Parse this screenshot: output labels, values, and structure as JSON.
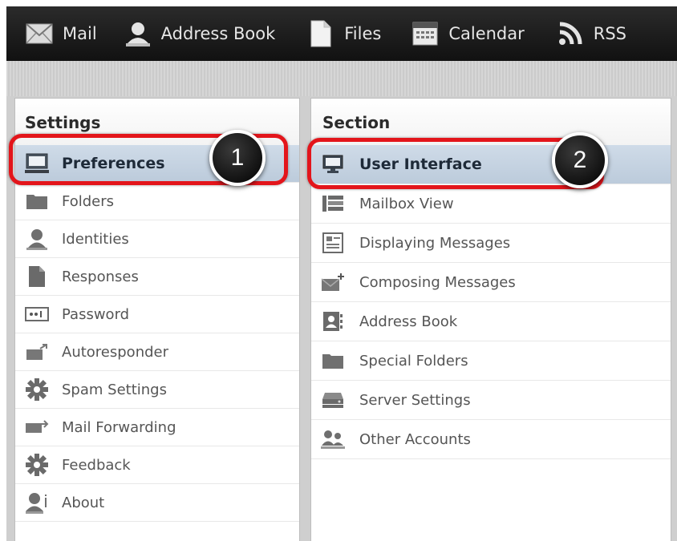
{
  "topnav": {
    "items": [
      {
        "label": "Mail",
        "icon": "mail-icon"
      },
      {
        "label": "Address Book",
        "icon": "person-icon"
      },
      {
        "label": "Files",
        "icon": "file-icon"
      },
      {
        "label": "Calendar",
        "icon": "calendar-icon"
      },
      {
        "label": "RSS",
        "icon": "rss-icon"
      }
    ]
  },
  "settings": {
    "title": "Settings",
    "items": [
      {
        "label": "Preferences",
        "icon": "monitor-icon",
        "selected": true
      },
      {
        "label": "Folders",
        "icon": "folder-icon"
      },
      {
        "label": "Identities",
        "icon": "person-icon"
      },
      {
        "label": "Responses",
        "icon": "document-icon"
      },
      {
        "label": "Password",
        "icon": "password-icon"
      },
      {
        "label": "Autoresponder",
        "icon": "autoresponder-icon"
      },
      {
        "label": "Spam Settings",
        "icon": "gear-icon"
      },
      {
        "label": "Mail Forwarding",
        "icon": "mail-forward-icon"
      },
      {
        "label": "Feedback",
        "icon": "gear-icon"
      },
      {
        "label": "About",
        "icon": "person-info-icon"
      }
    ]
  },
  "section": {
    "title": "Section",
    "items": [
      {
        "label": "User Interface",
        "icon": "monitor-icon",
        "selected": true
      },
      {
        "label": "Mailbox View",
        "icon": "list-view-icon"
      },
      {
        "label": "Displaying Messages",
        "icon": "message-view-icon"
      },
      {
        "label": "Composing Messages",
        "icon": "compose-icon"
      },
      {
        "label": "Address Book",
        "icon": "address-book-icon"
      },
      {
        "label": "Special Folders",
        "icon": "folder-icon"
      },
      {
        "label": "Server Settings",
        "icon": "server-icon"
      },
      {
        "label": "Other Accounts",
        "icon": "people-icon"
      }
    ]
  },
  "callouts": {
    "one": "1",
    "two": "2"
  },
  "colors": {
    "highlight": "#e3151b",
    "selected_row": "#c6d4e2",
    "topbar": "#1c1c1c"
  }
}
